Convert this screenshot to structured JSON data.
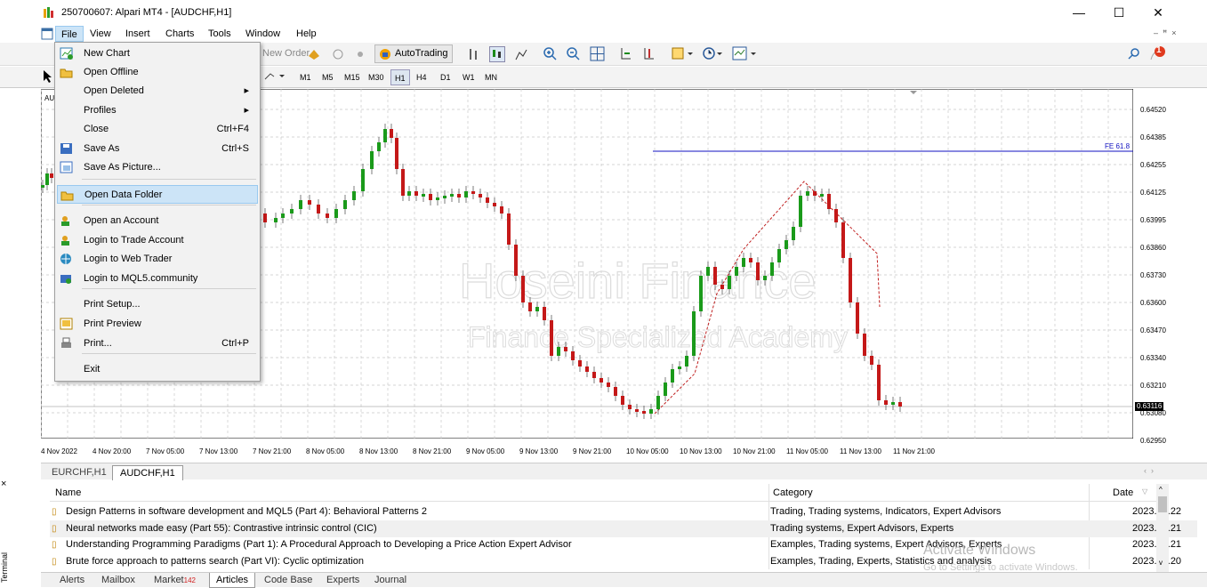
{
  "window": {
    "title": "250700607: Alpari MT4 - [AUDCHF,H1]",
    "minimize": "—",
    "maximize": "☐",
    "close": "✕"
  },
  "menubar": [
    "File",
    "View",
    "Insert",
    "Charts",
    "Tools",
    "Window",
    "Help"
  ],
  "toolbar": {
    "new_order": "New Order",
    "autotrading": "AutoTrading"
  },
  "timeframes": [
    "M1",
    "M5",
    "M15",
    "M30",
    "H1",
    "H4",
    "D1",
    "W1",
    "MN"
  ],
  "chart": {
    "symbol_label": "AU",
    "fe_label": "FE 61.8",
    "current_price": "0.63116",
    "watermark1": "Hoseini Finance",
    "watermark2": "Finance Specialized Academy",
    "price_labels": [
      "0.64520",
      "0.64385",
      "0.64255",
      "0.64125",
      "0.63995",
      "0.63860",
      "0.63730",
      "0.63600",
      "0.63470",
      "0.63340",
      "0.63210",
      "0.63080",
      "0.62950"
    ],
    "time_labels": [
      "4 Nov 2022",
      "4 Nov 20:00",
      "7 Nov 05:00",
      "7 Nov 13:00",
      "7 Nov 21:00",
      "8 Nov 05:00",
      "8 Nov 13:00",
      "8 Nov 21:00",
      "9 Nov 05:00",
      "9 Nov 13:00",
      "9 Nov 21:00",
      "10 Nov 05:00",
      "10 Nov 13:00",
      "10 Nov 21:00",
      "11 Nov 05:00",
      "11 Nov 13:00",
      "11 Nov 21:00"
    ]
  },
  "chart_tabs": [
    "EURCHF,H1",
    "AUDCHF,H1"
  ],
  "articles": {
    "headers": {
      "name": "Name",
      "category": "Category",
      "date": "Date"
    },
    "rows": [
      {
        "name": "Design Patterns in software development and MQL5 (Part 4): Behavioral Patterns 2",
        "category": "Trading, Trading systems, Indicators, Expert Advisors",
        "date": "2023.12.22"
      },
      {
        "name": "Neural networks made easy (Part 55): Contrastive intrinsic control (CIC)",
        "category": "Trading systems, Expert Advisors, Experts",
        "date": "2023.12.21"
      },
      {
        "name": "Understanding Programming Paradigms (Part 1): A Procedural Approach to Developing a Price Action Expert Advisor",
        "category": "Examples, Trading systems, Expert Advisors, Experts",
        "date": "2023.12.21"
      },
      {
        "name": "Brute force approach to patterns search (Part VI): Cyclic optimization",
        "category": "Examples, Trading, Experts, Statistics and analysis",
        "date": "2023.12.20"
      }
    ],
    "activate1": "Activate Windows",
    "activate2": "Go to Settings to activate Windows.",
    "side_label": "Terminal"
  },
  "bottom_tabs": {
    "alerts": "Alerts",
    "mailbox": "Mailbox",
    "market": "Market",
    "market_badge": "142",
    "articles": "Articles",
    "codebase": "Code Base",
    "experts": "Experts",
    "journal": "Journal"
  },
  "file_menu": [
    {
      "label": "New Chart",
      "shortcut": ""
    },
    {
      "label": "Open Offline",
      "shortcut": ""
    },
    {
      "label": "Open Deleted",
      "shortcut": "▸"
    },
    {
      "label": "Profiles",
      "shortcut": "▸"
    },
    {
      "label": "Close",
      "shortcut": "Ctrl+F4"
    },
    {
      "label": "Save As",
      "shortcut": "Ctrl+S"
    },
    {
      "label": "Save As Picture...",
      "shortcut": ""
    },
    {
      "label": "Open Data Folder",
      "shortcut": ""
    },
    {
      "label": "Open an Account",
      "shortcut": ""
    },
    {
      "label": "Login to Trade Account",
      "shortcut": ""
    },
    {
      "label": "Login to Web Trader",
      "shortcut": ""
    },
    {
      "label": "Login to MQL5.community",
      "shortcut": ""
    },
    {
      "label": "Print Setup...",
      "shortcut": ""
    },
    {
      "label": "Print Preview",
      "shortcut": ""
    },
    {
      "label": "Print...",
      "shortcut": "Ctrl+P"
    },
    {
      "label": "Exit",
      "shortcut": ""
    }
  ],
  "notification_count": "1"
}
